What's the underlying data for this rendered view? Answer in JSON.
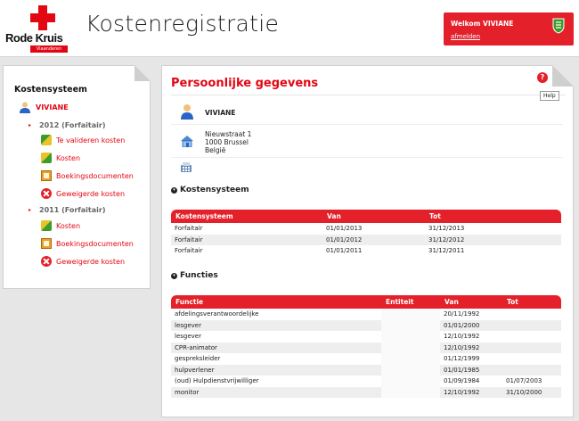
{
  "header": {
    "brand": "Rode Kruis",
    "brand_sub": "Vlaanderen",
    "app_title": "Kostenregistratie",
    "welcome": "Welkom VIVIANE",
    "logout": "afmelden",
    "accent": "#e4202a"
  },
  "sidebar": {
    "title": "Kostensysteem",
    "user": "VIVIANE",
    "years": [
      {
        "label": "2012 (Forfaitair)",
        "items": [
          "Te valideren kosten",
          "Kosten",
          "Boekingsdocumenten",
          "Geweigerde kosten"
        ]
      },
      {
        "label": "2011 (Forfaitair)",
        "items": [
          "Kosten",
          "Boekingsdocumenten",
          "Geweigerde kosten"
        ]
      }
    ]
  },
  "main": {
    "title": "Persoonlijke gegevens",
    "help_tip": "Help",
    "person": {
      "name": "VIVIANE",
      "address_line1": "Nieuwstraat 1",
      "address_line2": "1000 Brussel",
      "address_line3": "België"
    },
    "kostensysteem": {
      "heading": "Kostensysteem",
      "columns": [
        "Kostensysteem",
        "Van",
        "Tot"
      ],
      "rows": [
        [
          "Forfaitair",
          "01/01/2013",
          "31/12/2013"
        ],
        [
          "Forfaitair",
          "01/01/2012",
          "31/12/2012"
        ],
        [
          "Forfaitair",
          "01/01/2011",
          "31/12/2011"
        ]
      ]
    },
    "functies": {
      "heading": "Functies",
      "columns": [
        "Functie",
        "Entiteit",
        "Van",
        "Tot"
      ],
      "rows": [
        [
          "afdelingsverantwoordelijke",
          "",
          "20/11/1992",
          ""
        ],
        [
          "lesgever",
          "",
          "01/01/2000",
          ""
        ],
        [
          "lesgever",
          "",
          "12/10/1992",
          ""
        ],
        [
          "CPR-animator",
          "",
          "12/10/1992",
          ""
        ],
        [
          "gespreksleider",
          "",
          "01/12/1999",
          ""
        ],
        [
          "hulpverlener",
          "",
          "01/01/1985",
          ""
        ],
        [
          "(oud) Hulpdienstvrijwilliger",
          "",
          "01/09/1984",
          "01/07/2003"
        ],
        [
          "monitor",
          "",
          "12/10/1992",
          "31/10/2000"
        ]
      ]
    }
  }
}
